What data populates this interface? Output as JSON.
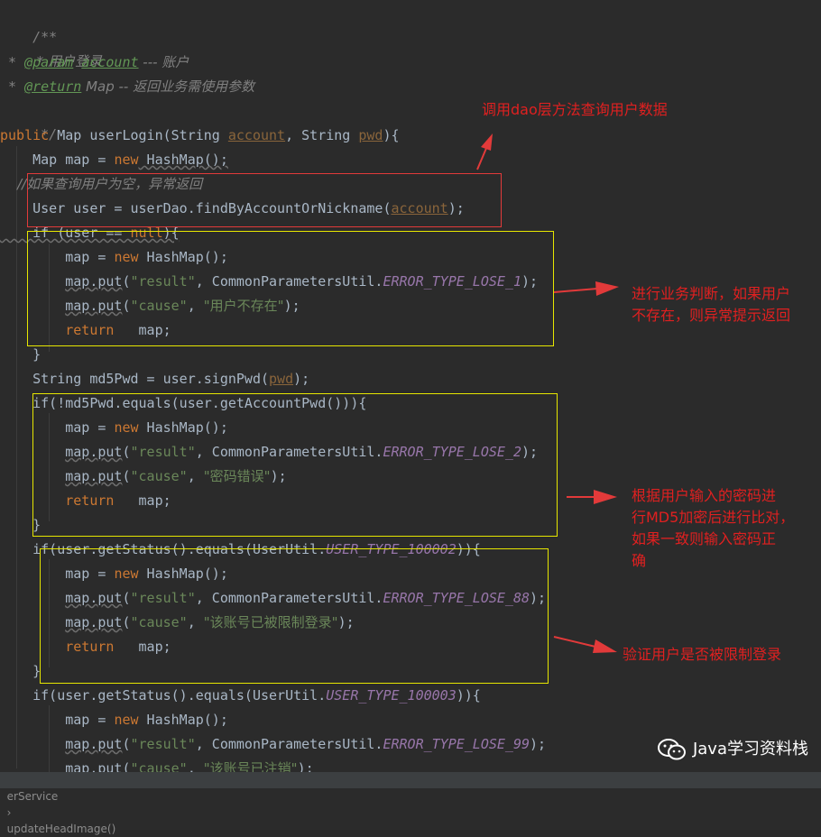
{
  "code": {
    "doc_open": "/**",
    "doc_user_login": " * 用户登录",
    "doc_param_tag": "@param",
    "doc_param_name": "account",
    "doc_param_desc": " --- 账户",
    "doc_return_tag": "@return",
    "doc_return_desc": " Map -- 返回业务需使用参数",
    "doc_close": " */",
    "l_public": "public",
    "l_signature": " Map userLogin(String ",
    "p_account": "account",
    "l_comma_string": ", String ",
    "p_pwd": "pwd",
    "l_sig_end": "){",
    "map_decl": "    Map map = ",
    "kw_new": "new",
    "hashmap_call": " HashMap();",
    "comment_if_null": "    //如果查询用户为空，异常返回",
    "user_decl": "    User user = userDao.findByAccountOrNickname(",
    "user_decl_end": ");",
    "if_null_a": "    if (user == ",
    "kw_null": "null",
    "if_null_b": "){",
    "map_assign": "        map = ",
    "put_indent": "        ",
    "map_put": "map.put",
    "put_open": "(",
    "str_result": "\"result\"",
    "put_sep": ", CommonParametersUtil.",
    "lose1": "ERROR_TYPE_LOSE_1",
    "put_close": ");",
    "str_cause": "\"cause\"",
    "str_comma": ", ",
    "str_user_not_exist": "\"用户不存在\"",
    "ret_indent": "        ",
    "kw_return": "return",
    "ret_map": "   map;",
    "brace_close": "    }",
    "md5_decl_a": "    String md5Pwd = user.signPwd(",
    "md5_decl_b": ");",
    "if_md5_a": "    if(!md5Pwd.equals(user.getAccountPwd())){",
    "lose2": "ERROR_TYPE_LOSE_2",
    "str_wrong_pwd": "\"密码错误\"",
    "if_status_a": "    if(user.getStatus().equals(UserUtil.",
    "type_100002": "USER_TYPE_100002",
    "if_status_end": ")){",
    "lose88": "ERROR_TYPE_LOSE_88",
    "str_limited": "\"该账号已被限制登录\"",
    "type_100003": "USER_TYPE_100003",
    "lose99": "ERROR_TYPE_LOSE_99",
    "str_cancelled": "\"该账号已注销\""
  },
  "annotations": {
    "dao": "调用dao层方法查询用户数据",
    "business_1": "进行业务判断，如果用户",
    "business_2": "不存在，则异常提示返回",
    "md5_1": "根据用户输入的密码进",
    "md5_2": "行MD5加密后进行比对，",
    "md5_3": "如果一致则输入密码正",
    "md5_4": "确",
    "limited": "验证用户是否被限制登录"
  },
  "statusbar": {
    "class_crumb": "erService",
    "separator": "›",
    "method_crumb": "updateHeadImage()"
  },
  "watermark": {
    "text": "Java学习资料栈",
    "icon": "wechat-icon"
  },
  "colors": {
    "background": "#2b2b2b",
    "keyword": "#cc7832",
    "string": "#6a8759",
    "annotation_red": "#e02020",
    "box_red": "#e23a3a",
    "box_yellow": "#e6e600"
  }
}
